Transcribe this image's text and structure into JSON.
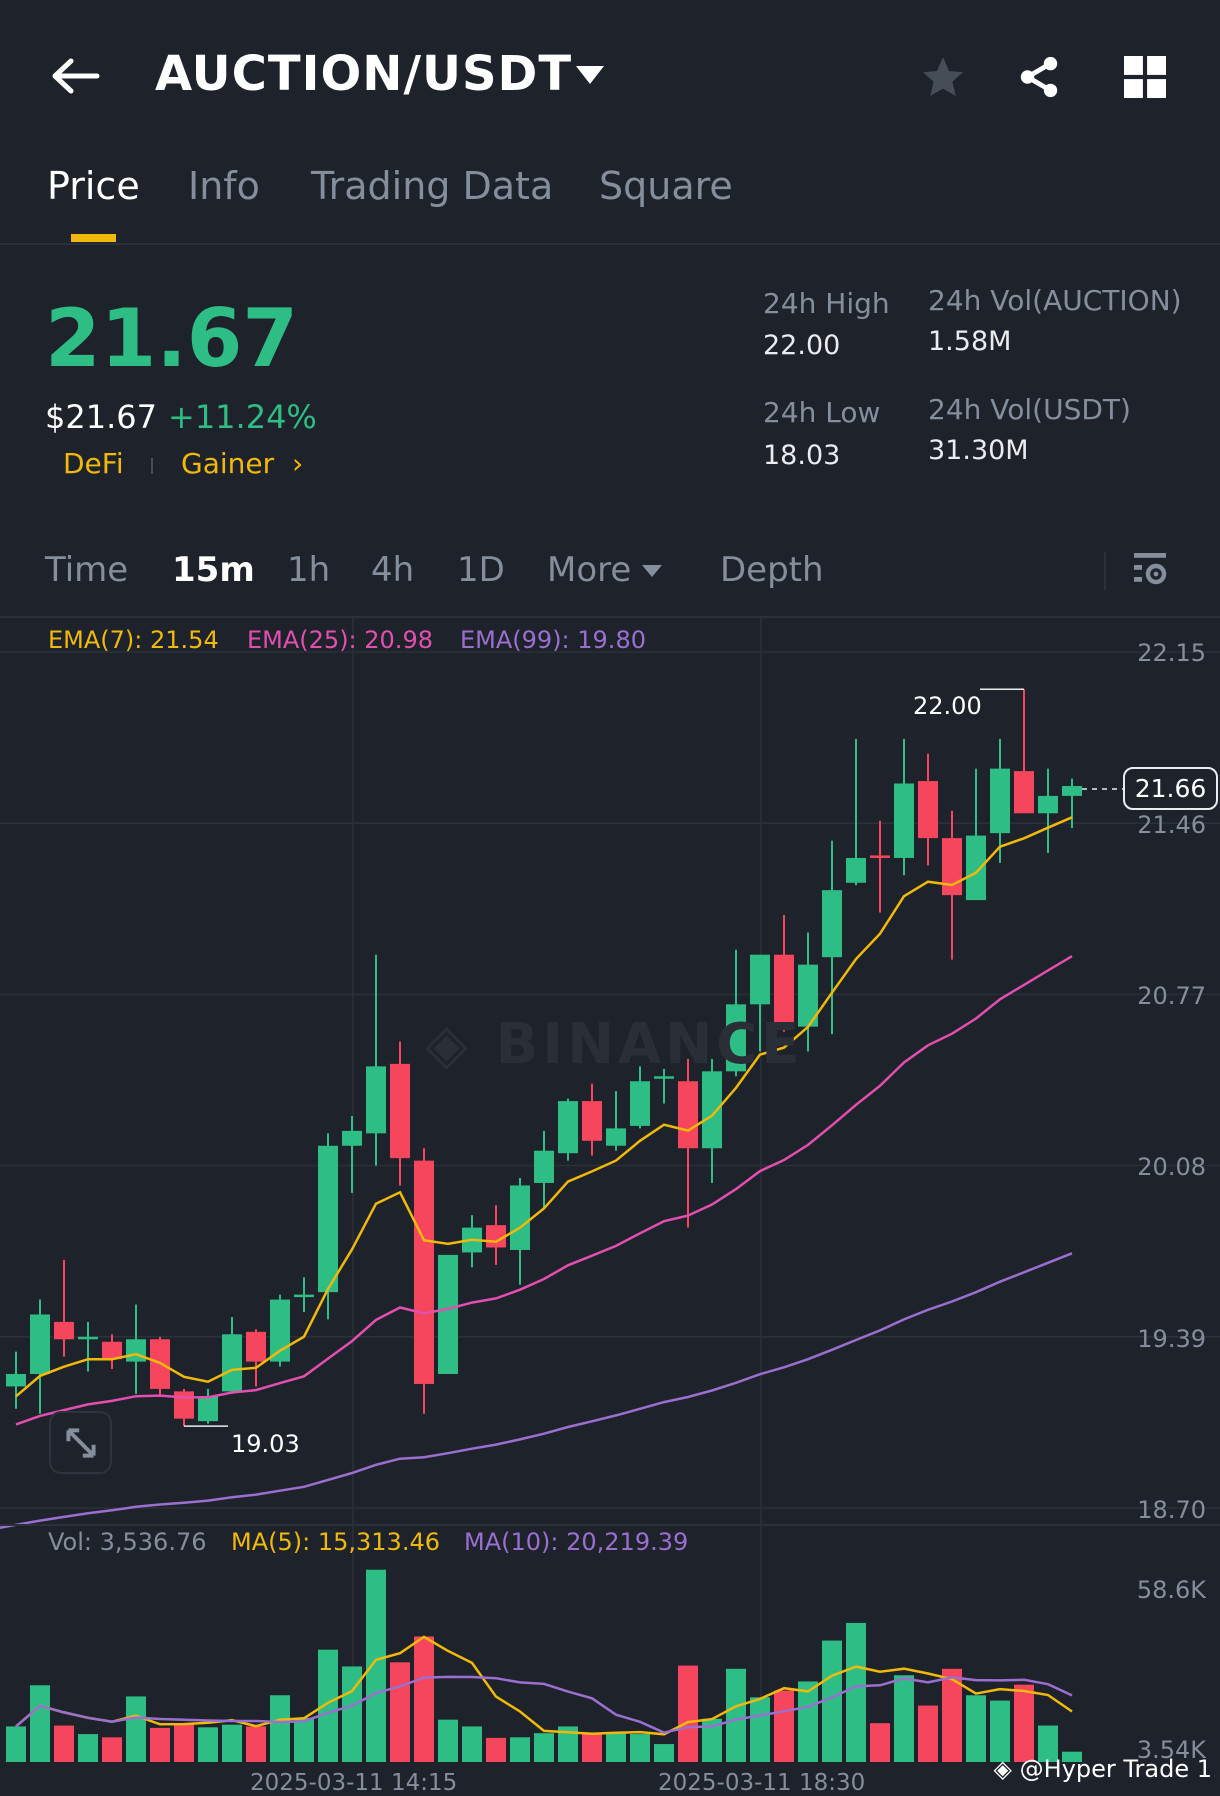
{
  "header": {
    "title": "AUCTION/USDT"
  },
  "tabs": [
    {
      "label": "Price"
    },
    {
      "label": "Info"
    },
    {
      "label": "Trading Data"
    },
    {
      "label": "Square"
    }
  ],
  "ticker": {
    "last_price": "21.67",
    "usd_price": "$21.67",
    "change": "+11.24%",
    "tags": [
      "DeFi",
      "Gainer"
    ],
    "high_label": "24h High",
    "high": "22.00",
    "low_label": "24h Low",
    "low": "18.03",
    "vol_base_label": "24h Vol(AUCTION)",
    "vol_base": "1.58M",
    "vol_quote_label": "24h Vol(USDT)",
    "vol_quote": "31.30M"
  },
  "timeframes": [
    {
      "label": "Time"
    },
    {
      "label": "15m"
    },
    {
      "label": "1h"
    },
    {
      "label": "4h"
    },
    {
      "label": "1D"
    },
    {
      "label": "More"
    },
    {
      "label": "Depth"
    }
  ],
  "colors": {
    "up": "#2ebd85",
    "down": "#f6465d",
    "ema7": "#f0b90b",
    "ema25": "#e24fb0",
    "ema99": "#9b6fd0",
    "accent": "#f0b90b"
  },
  "legend": {
    "ema7": "EMA(7): 21.54",
    "ema25": "EMA(25): 20.98",
    "ema99": "EMA(99): 19.80",
    "vol": "Vol: 3,536.76",
    "ma5": "MA(5): 15,313.46",
    "ma10": "MA(10): 20,219.39"
  },
  "watermark": "BINANCE",
  "credit": "@Hyper Trade 1",
  "chart_data": {
    "type": "candlestick",
    "price_axis": [
      "22.15",
      "21.46",
      "20.77",
      "20.08",
      "19.39",
      "18.70"
    ],
    "ylim": [
      18.7,
      22.15
    ],
    "current_price": "21.66",
    "high_marker": "22.00",
    "low_marker": "19.03",
    "volume_axis": [
      "58.6K",
      "3.54K"
    ],
    "x_labels": [
      "2025-03-11 14:15",
      "2025-03-11 18:30"
    ],
    "ema_seeds": {
      "ema7": 19.12,
      "ema25": 19.02,
      "ema99": 18.62
    },
    "candles": [
      [
        19.19,
        19.24,
        19.33,
        19.1
      ],
      [
        19.24,
        19.48,
        19.54,
        19.08
      ],
      [
        19.45,
        19.38,
        19.7,
        19.31
      ],
      [
        19.38,
        19.39,
        19.45,
        19.25
      ],
      [
        19.37,
        19.3,
        19.4,
        19.26
      ],
      [
        19.29,
        19.38,
        19.52,
        19.16
      ],
      [
        19.38,
        19.18,
        19.39,
        19.15
      ],
      [
        19.17,
        19.06,
        19.18,
        19.03
      ],
      [
        19.05,
        19.15,
        19.18,
        19.04
      ],
      [
        19.17,
        19.4,
        19.47,
        19.16
      ],
      [
        19.41,
        19.29,
        19.42,
        19.19
      ],
      [
        19.29,
        19.54,
        19.56,
        19.27
      ],
      [
        19.55,
        19.56,
        19.63,
        19.49
      ],
      [
        19.57,
        20.16,
        20.21,
        19.46
      ],
      [
        20.16,
        20.22,
        20.28,
        19.97
      ],
      [
        20.21,
        20.48,
        20.93,
        20.08
      ],
      [
        20.49,
        20.11,
        20.58,
        20.0
      ],
      [
        20.1,
        19.2,
        20.15,
        19.08
      ],
      [
        19.24,
        19.72,
        19.72,
        19.24
      ],
      [
        19.73,
        19.83,
        19.88,
        19.67
      ],
      [
        19.84,
        19.75,
        19.92,
        19.68
      ],
      [
        19.74,
        20.0,
        20.03,
        19.6
      ],
      [
        20.01,
        20.14,
        20.22,
        19.91
      ],
      [
        20.13,
        20.34,
        20.35,
        20.1
      ],
      [
        20.34,
        20.18,
        20.41,
        20.12
      ],
      [
        20.16,
        20.23,
        20.38,
        20.14
      ],
      [
        20.24,
        20.42,
        20.48,
        20.23
      ],
      [
        20.43,
        20.44,
        20.47,
        20.33
      ],
      [
        20.42,
        20.15,
        20.51,
        19.83
      ],
      [
        20.15,
        20.46,
        20.51,
        20.01
      ],
      [
        20.46,
        20.73,
        20.95,
        20.44
      ],
      [
        20.73,
        20.93,
        20.93,
        20.54
      ],
      [
        20.93,
        20.64,
        21.09,
        20.62
      ],
      [
        20.64,
        20.89,
        21.02,
        20.54
      ],
      [
        20.92,
        21.19,
        21.39,
        20.61
      ],
      [
        21.22,
        21.32,
        21.8,
        21.21
      ],
      [
        21.33,
        21.32,
        21.47,
        21.1
      ],
      [
        21.32,
        21.62,
        21.8,
        21.25
      ],
      [
        21.63,
        21.4,
        21.74,
        21.29
      ],
      [
        21.4,
        21.17,
        21.51,
        20.91
      ],
      [
        21.15,
        21.41,
        21.68,
        21.15
      ],
      [
        21.42,
        21.68,
        21.8,
        21.3
      ],
      [
        21.67,
        21.5,
        22.0,
        21.5
      ],
      [
        21.5,
        21.57,
        21.68,
        21.34
      ],
      [
        21.57,
        21.61,
        21.64,
        21.44
      ]
    ],
    "volume_k": [
      12.1,
      26.1,
      12.4,
      9.5,
      8.4,
      22.3,
      11.6,
      12.7,
      11.8,
      12.7,
      12.1,
      22.7,
      15.0,
      38.2,
      32.5,
      65.4,
      33.9,
      42.7,
      14.4,
      12.1,
      8.2,
      8.4,
      9.8,
      12.1,
      9.5,
      9.9,
      9.5,
      6.1,
      32.8,
      14.7,
      31.7,
      22.0,
      24.3,
      27.4,
      41.3,
      47.3,
      13.2,
      29.5,
      19.2,
      31.7,
      22.7,
      20.9,
      26.3,
      12.4,
      3.5
    ]
  }
}
